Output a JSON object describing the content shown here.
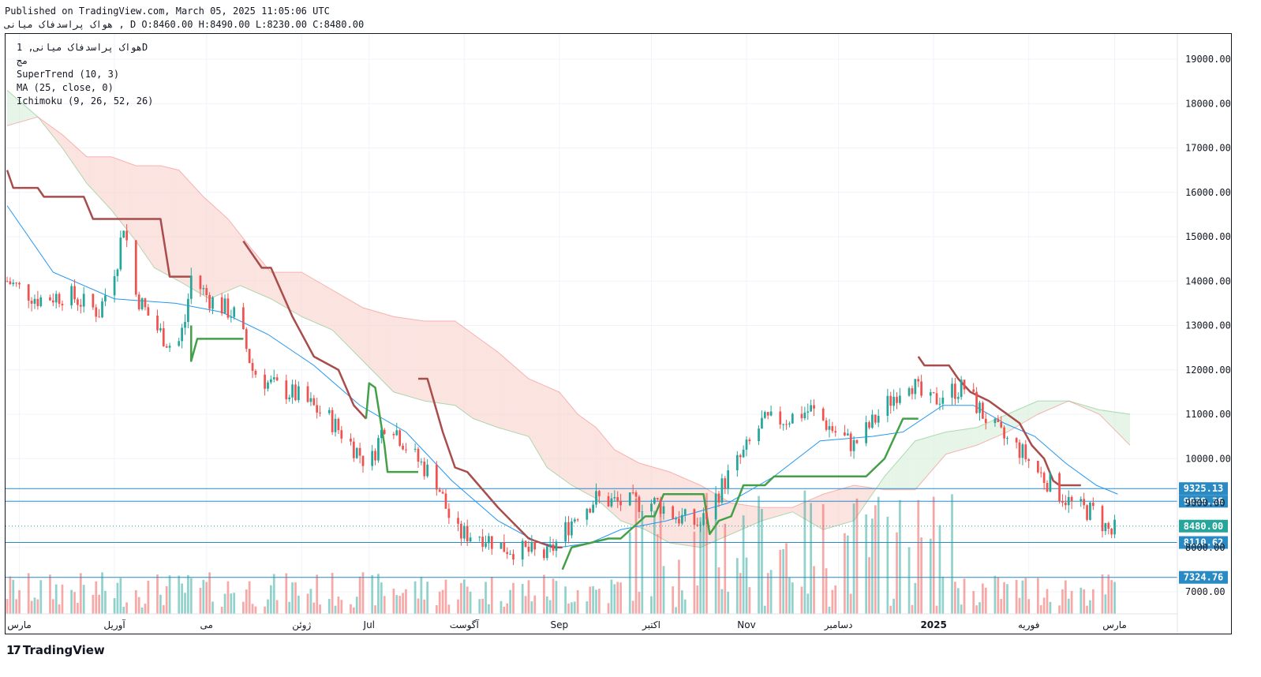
{
  "header": {
    "published": "Published on TradingView.com, March 05, 2025 11:05:06 UTC",
    "ohlc": "هواک پراسدفاک میانی , D O:8460.00 H:8490.00 L:8230.00 C:8480.00"
  },
  "legend": {
    "symbol": "هواک پراسدفاک میانی, 1D",
    "sub": "مج",
    "supertrend": "SuperTrend (10, 3)",
    "ma": "MA (25, close, 0)",
    "ichimoku": "Ichimoku (9, 26, 52, 26)"
  },
  "brand": "TradingView",
  "colors": {
    "up": "#26a69a",
    "down": "#ef5350",
    "supertrend_up": "#43a047",
    "supertrend_down": "#a84c4c",
    "ma": "#2196f3",
    "cloud_bear": "#f9d0cc",
    "cloud_bull": "#d7eed8",
    "hline": "#2a8ac4",
    "last_price": "#26a69a"
  },
  "chart_data": {
    "type": "candlestick",
    "ylim": [
      6500,
      19600
    ],
    "y_ticks": [
      "19000.00",
      "18000.00",
      "17000.00",
      "16000.00",
      "15000.00",
      "14000.00",
      "13000.00",
      "12000.00",
      "11000.00",
      "10000.00",
      "9000.00",
      "8000.00",
      "7000.00"
    ],
    "x_ticks": [
      "مارس",
      "آوریل",
      "می",
      "ژوئن",
      "Jul",
      "آگوست",
      "Sep",
      "اکتبر",
      "Nov",
      "دسامبر",
      "2025",
      "فوریه",
      "مارس"
    ],
    "x_tick_days": [
      4,
      35,
      65,
      96,
      118,
      149,
      180,
      210,
      241,
      271,
      302,
      333,
      361
    ],
    "total_days": 366,
    "horizontal_levels": [
      {
        "value": 9325.13,
        "label": "9325.13"
      },
      {
        "value": 9039.36,
        "label": "9039.36"
      },
      {
        "value": 8110.62,
        "label": "8110.62"
      },
      {
        "value": 7324.76,
        "label": "7324.76"
      }
    ],
    "last_price": {
      "value": 8480.0,
      "label": "8480.00"
    },
    "close_path": [
      [
        0,
        14000
      ],
      [
        10,
        13600
      ],
      [
        20,
        13700
      ],
      [
        30,
        13300
      ],
      [
        36,
        14500
      ],
      [
        38,
        15300
      ],
      [
        42,
        13700
      ],
      [
        48,
        13000
      ],
      [
        55,
        12400
      ],
      [
        58,
        13100
      ],
      [
        60,
        14100
      ],
      [
        66,
        13600
      ],
      [
        75,
        13200
      ],
      [
        80,
        12000
      ],
      [
        85,
        11700
      ],
      [
        95,
        11400
      ],
      [
        105,
        10900
      ],
      [
        115,
        10100
      ],
      [
        118,
        9800
      ],
      [
        124,
        11000
      ],
      [
        128,
        10500
      ],
      [
        132,
        10100
      ],
      [
        140,
        9500
      ],
      [
        146,
        8300
      ],
      [
        154,
        8300
      ],
      [
        162,
        8000
      ],
      [
        170,
        7900
      ],
      [
        176,
        7800
      ],
      [
        180,
        8200
      ],
      [
        186,
        8800
      ],
      [
        192,
        9100
      ],
      [
        200,
        9000
      ],
      [
        212,
        9000
      ],
      [
        218,
        8700
      ],
      [
        226,
        8500
      ],
      [
        234,
        9500
      ],
      [
        240,
        10100
      ],
      [
        246,
        10800
      ],
      [
        254,
        10900
      ],
      [
        262,
        11100
      ],
      [
        270,
        10600
      ],
      [
        276,
        10300
      ],
      [
        282,
        10800
      ],
      [
        290,
        11500
      ],
      [
        294,
        11800
      ],
      [
        300,
        11200
      ],
      [
        306,
        11500
      ],
      [
        312,
        11600
      ],
      [
        318,
        11000
      ],
      [
        324,
        10500
      ],
      [
        330,
        10200
      ],
      [
        336,
        9700
      ],
      [
        342,
        9300
      ],
      [
        348,
        8900
      ],
      [
        354,
        8800
      ],
      [
        360,
        8300
      ],
      [
        362,
        8480
      ]
    ],
    "ma25": [
      [
        0,
        15700
      ],
      [
        15,
        14200
      ],
      [
        35,
        13600
      ],
      [
        55,
        13500
      ],
      [
        70,
        13300
      ],
      [
        85,
        12800
      ],
      [
        100,
        12100
      ],
      [
        115,
        11200
      ],
      [
        130,
        10600
      ],
      [
        145,
        9500
      ],
      [
        160,
        8600
      ],
      [
        172,
        8150
      ],
      [
        180,
        8000
      ],
      [
        190,
        8100
      ],
      [
        200,
        8400
      ],
      [
        215,
        8600
      ],
      [
        235,
        9000
      ],
      [
        250,
        9600
      ],
      [
        265,
        10400
      ],
      [
        282,
        10500
      ],
      [
        292,
        10600
      ],
      [
        305,
        11200
      ],
      [
        315,
        11200
      ],
      [
        325,
        10800
      ],
      [
        335,
        10500
      ],
      [
        345,
        9900
      ],
      [
        355,
        9400
      ],
      [
        362,
        9200
      ]
    ],
    "supertrend": [
      {
        "trend": "down",
        "points": [
          [
            0,
            16500
          ],
          [
            2,
            16100
          ],
          [
            10,
            16100
          ],
          [
            12,
            15900
          ],
          [
            25,
            15900
          ],
          [
            28,
            15400
          ],
          [
            50,
            15400
          ],
          [
            53,
            14100
          ],
          [
            60,
            14100
          ]
        ]
      },
      {
        "trend": "up",
        "points": [
          [
            60,
            13000
          ],
          [
            60,
            12200
          ],
          [
            62,
            12700
          ],
          [
            77,
            12700
          ]
        ]
      },
      {
        "trend": "down",
        "points": [
          [
            77,
            14900
          ],
          [
            83,
            14300
          ],
          [
            86,
            14300
          ],
          [
            93,
            13200
          ],
          [
            100,
            12300
          ],
          [
            108,
            12000
          ],
          [
            113,
            11200
          ],
          [
            117,
            10900
          ]
        ]
      },
      {
        "trend": "up",
        "points": [
          [
            117,
            10900
          ],
          [
            118,
            11700
          ],
          [
            120,
            11600
          ],
          [
            123,
            10300
          ],
          [
            124,
            9700
          ],
          [
            134,
            9700
          ]
        ]
      },
      {
        "trend": "down",
        "points": [
          [
            134,
            11800
          ],
          [
            137,
            11800
          ],
          [
            142,
            10600
          ],
          [
            146,
            9800
          ],
          [
            150,
            9700
          ],
          [
            160,
            8900
          ],
          [
            170,
            8200
          ],
          [
            178,
            8000
          ],
          [
            181,
            8000
          ]
        ]
      },
      {
        "trend": "up",
        "points": [
          [
            181,
            7500
          ],
          [
            184,
            8000
          ],
          [
            190,
            8100
          ],
          [
            196,
            8200
          ],
          [
            200,
            8200
          ],
          [
            208,
            8700
          ],
          [
            211,
            8700
          ],
          [
            214,
            9200
          ],
          [
            227,
            9200
          ],
          [
            229,
            8300
          ],
          [
            232,
            8600
          ],
          [
            236,
            8700
          ],
          [
            240,
            9400
          ],
          [
            247,
            9400
          ],
          [
            250,
            9600
          ],
          [
            260,
            9600
          ],
          [
            270,
            9600
          ],
          [
            280,
            9600
          ],
          [
            283,
            9800
          ],
          [
            286,
            10000
          ],
          [
            288,
            10300
          ],
          [
            292,
            10900
          ],
          [
            297,
            10900
          ]
        ]
      },
      {
        "trend": "down",
        "points": [
          [
            297,
            12300
          ],
          [
            299,
            12100
          ],
          [
            307,
            12100
          ],
          [
            310,
            11800
          ],
          [
            314,
            11500
          ],
          [
            320,
            11300
          ],
          [
            326,
            11000
          ],
          [
            330,
            10800
          ],
          [
            334,
            10300
          ],
          [
            338,
            10000
          ],
          [
            341,
            9500
          ],
          [
            343,
            9400
          ],
          [
            350,
            9400
          ]
        ]
      }
    ],
    "senkou_a": [
      [
        0,
        18300
      ],
      [
        10,
        17700
      ],
      [
        18,
        17000
      ],
      [
        26,
        16200
      ],
      [
        34,
        15600
      ],
      [
        42,
        14900
      ],
      [
        48,
        14300
      ],
      [
        56,
        14000
      ],
      [
        66,
        13600
      ],
      [
        76,
        13900
      ],
      [
        86,
        13600
      ],
      [
        96,
        13200
      ],
      [
        106,
        12900
      ],
      [
        116,
        12200
      ],
      [
        126,
        11500
      ],
      [
        136,
        11300
      ],
      [
        146,
        11200
      ],
      [
        152,
        10900
      ],
      [
        160,
        10700
      ],
      [
        170,
        10500
      ],
      [
        176,
        9800
      ],
      [
        184,
        9400
      ],
      [
        192,
        9100
      ],
      [
        200,
        8600
      ],
      [
        208,
        8400
      ],
      [
        216,
        8100
      ],
      [
        226,
        8000
      ],
      [
        236,
        8300
      ],
      [
        246,
        8600
      ],
      [
        256,
        8800
      ],
      [
        266,
        8400
      ],
      [
        276,
        8600
      ],
      [
        286,
        9600
      ],
      [
        296,
        10400
      ],
      [
        306,
        10600
      ],
      [
        316,
        10700
      ],
      [
        326,
        11000
      ],
      [
        336,
        11300
      ],
      [
        346,
        11300
      ],
      [
        356,
        11100
      ],
      [
        366,
        11000
      ]
    ],
    "senkou_b": [
      [
        0,
        17500
      ],
      [
        10,
        17700
      ],
      [
        18,
        17300
      ],
      [
        26,
        16800
      ],
      [
        34,
        16800
      ],
      [
        42,
        16600
      ],
      [
        50,
        16600
      ],
      [
        56,
        16500
      ],
      [
        64,
        15900
      ],
      [
        72,
        15400
      ],
      [
        80,
        14700
      ],
      [
        86,
        14200
      ],
      [
        96,
        14200
      ],
      [
        106,
        13800
      ],
      [
        116,
        13400
      ],
      [
        126,
        13200
      ],
      [
        136,
        13100
      ],
      [
        146,
        13100
      ],
      [
        150,
        12900
      ],
      [
        160,
        12400
      ],
      [
        170,
        11800
      ],
      [
        180,
        11500
      ],
      [
        186,
        11000
      ],
      [
        192,
        10700
      ],
      [
        198,
        10200
      ],
      [
        206,
        9900
      ],
      [
        216,
        9700
      ],
      [
        226,
        9400
      ],
      [
        236,
        9000
      ],
      [
        246,
        8900
      ],
      [
        256,
        8900
      ],
      [
        266,
        9200
      ],
      [
        276,
        9400
      ],
      [
        286,
        9300
      ],
      [
        296,
        9300
      ],
      [
        306,
        10100
      ],
      [
        316,
        10300
      ],
      [
        326,
        10600
      ],
      [
        336,
        11000
      ],
      [
        346,
        11300
      ],
      [
        356,
        11000
      ],
      [
        366,
        10300
      ]
    ],
    "volume_max_ratio": 1.0
  }
}
